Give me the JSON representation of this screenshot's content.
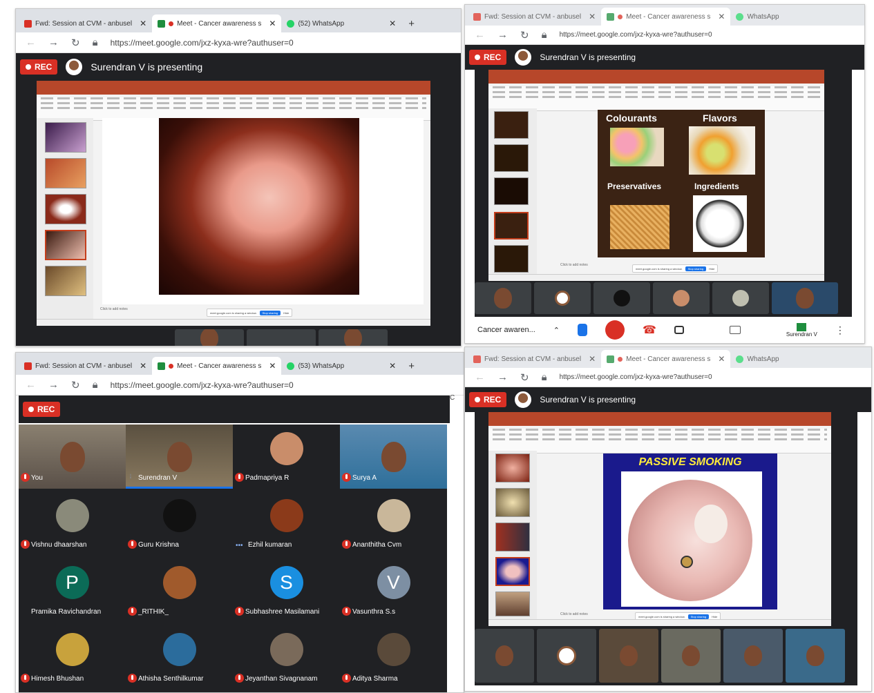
{
  "tabs": {
    "gmail": "Fwd: Session at CVM - anbusel",
    "meet": "Meet - Cancer awareness s",
    "whatsapp_q1": "(52) WhatsApp",
    "whatsapp_q3": "(53) WhatsApp"
  },
  "url": "https://meet.google.com/jxz-kyxa-wre?authuser=0",
  "rec_label": "REC",
  "presenting_text": "Surendran V is presenting",
  "meeting_name": "Cancer awaren...",
  "self_label": "Surendran V",
  "slides": {
    "passive_smoking_title": "PASSIVE SMOKING",
    "food_cells": [
      "Colourants",
      "Flavors",
      "Preservatives",
      "Ingredients"
    ],
    "click_notes": "Click to add notes",
    "stop_sharing": "Stop sharing",
    "hide": "Hide"
  },
  "participants": [
    {
      "name": "You",
      "state": "muted",
      "kind": "camera"
    },
    {
      "name": "Surendran V",
      "state": "speaking",
      "kind": "camera"
    },
    {
      "name": "Padmapriya R",
      "state": "muted",
      "kind": "avatar",
      "color": "#c98d6a"
    },
    {
      "name": "Surya A",
      "state": "muted",
      "kind": "camera"
    },
    {
      "name": "Vishnu dhaarshan",
      "state": "muted",
      "kind": "avatar",
      "color": "#8a8a7a"
    },
    {
      "name": "Guru Krishna",
      "state": "muted",
      "kind": "avatar",
      "color": "#111111"
    },
    {
      "name": "Ezhil kumaran",
      "state": "more",
      "kind": "avatar",
      "color": "#8b3a1a"
    },
    {
      "name": "Ananthitha Cvm",
      "state": "muted",
      "kind": "avatar",
      "color": "#c9b79a"
    },
    {
      "name": "Pramika Ravichandran",
      "state": "none",
      "kind": "letter",
      "letter": "P",
      "color": "#0b6b57"
    },
    {
      "name": "_RITHIK_",
      "state": "muted",
      "kind": "avatar",
      "color": "#a05a2c"
    },
    {
      "name": "Subhashree Masilamani",
      "state": "muted",
      "kind": "letter",
      "letter": "S",
      "color": "#1a8fe0"
    },
    {
      "name": "Vasunthra S.s",
      "state": "muted",
      "kind": "letter",
      "letter": "V",
      "color": "#7d8fa3"
    },
    {
      "name": "Himesh Bhushan",
      "state": "muted",
      "kind": "avatar",
      "color": "#c8a23c"
    },
    {
      "name": "Athisha Senthilkumar",
      "state": "muted",
      "kind": "avatar",
      "color": "#2b6c9c"
    },
    {
      "name": "Jeyanthan Sivagnanam",
      "state": "muted",
      "kind": "avatar",
      "color": "#7a6a5a"
    },
    {
      "name": "Aditya Sharma",
      "state": "muted",
      "kind": "avatar",
      "color": "#5a4a3a"
    }
  ]
}
